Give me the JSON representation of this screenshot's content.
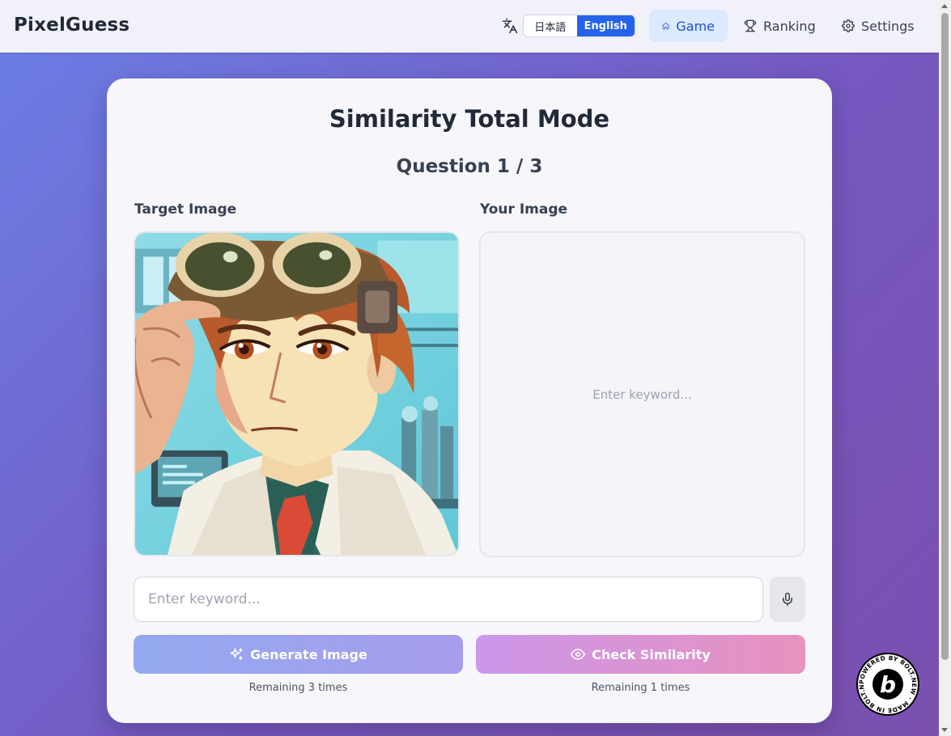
{
  "header": {
    "logo": "PixelGuess",
    "language": {
      "options": [
        "日本語",
        "English"
      ],
      "selected": "English"
    },
    "nav": [
      {
        "label": "Game",
        "icon": "home-icon",
        "active": true
      },
      {
        "label": "Ranking",
        "icon": "trophy-icon",
        "active": false
      },
      {
        "label": "Settings",
        "icon": "gear-icon",
        "active": false
      }
    ]
  },
  "card": {
    "title": "Similarity Total Mode",
    "question": "Question 1 / 3",
    "target_label": "Target Image",
    "your_label": "Your Image",
    "your_placeholder": "Enter keyword...",
    "input_placeholder": "Enter keyword...",
    "input_value": "",
    "generate_label": "Generate Image",
    "check_label": "Check Similarity",
    "generate_remaining": "Remaining 3 times",
    "check_remaining": "Remaining 1 times"
  },
  "badge": {
    "text": "POWERED BY BOLT.NEW · MADE IN BOLT.NEW ·",
    "letter": "b"
  },
  "colors": {
    "primary": "#2563eb",
    "nav_active_bg": "#dbeafe",
    "generate_gradient": [
      "#93a9f0",
      "#a79cee"
    ],
    "check_gradient": [
      "#cc96ea",
      "#e892bd"
    ],
    "background_gradient": [
      "#6b7fe6",
      "#7a4fae"
    ]
  }
}
